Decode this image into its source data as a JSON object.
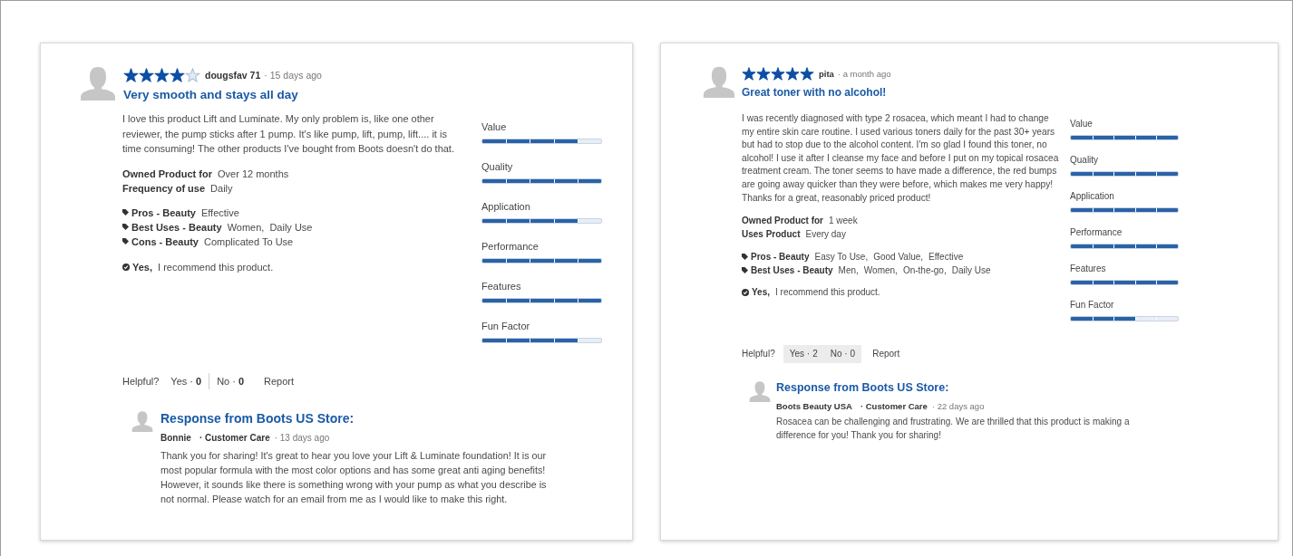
{
  "reviews": [
    {
      "reviewer": "dougsfav 71",
      "time": "· 15 days ago",
      "stars": 4,
      "title": "Very smooth and stays all day",
      "body": "I love this product Lift and Luminate. My only problem is, like one other reviewer, the pump sticks after 1 pump. It's like pump, lift, pump, lift.... it is time consuming! The other products I've bought from Boots doesn't do that.",
      "details": [
        {
          "label": "Owned Product for",
          "value": "Over 12 months"
        },
        {
          "label": "Frequency of use",
          "value": "Daily"
        }
      ],
      "tags": [
        {
          "label": "Pros - Beauty",
          "values": [
            "Effective"
          ]
        },
        {
          "label": "Best Uses - Beauty",
          "values": [
            "Women,",
            "Daily Use"
          ]
        },
        {
          "label": "Cons - Beauty",
          "values": [
            "Complicated To Use"
          ]
        }
      ],
      "recommend": {
        "answer": "Yes,",
        "text": "I recommend this product."
      },
      "ratings": [
        {
          "name": "Value",
          "level": 0.8
        },
        {
          "name": "Quality",
          "level": 1
        },
        {
          "name": "Application",
          "level": 0.8
        },
        {
          "name": "Performance",
          "level": 1
        },
        {
          "name": "Features",
          "level": 1
        },
        {
          "name": "Fun Factor",
          "level": 0.8
        }
      ],
      "helpful": {
        "label": "Helpful?",
        "highlighted": false,
        "yes": {
          "label": "Yes ·",
          "count": "0"
        },
        "no": {
          "label": "No ·",
          "count": "0"
        },
        "report": "Report"
      },
      "response": {
        "title": "Response from Boots US Store:",
        "author": "Bonnie",
        "role": "· Customer Care",
        "time": "· 13 days ago",
        "body": "Thank you for sharing! It's great to hear you love your Lift & Luminate foundation! It is our most popular formula with the most color options and has some great anti aging benefits! However, it sounds like there is something wrong with your pump as what you describe is not normal. Please watch for an email from me as I would like to make this right."
      }
    },
    {
      "reviewer": "pita",
      "time": "· a month ago",
      "stars": 5,
      "title": "Great toner with no alcohol!",
      "body": "I was recently diagnosed with type 2 rosacea, which meant I had to change my entire skin care routine. I used various toners daily for the past 30+ years but had to stop due to the alcohol content. I'm so glad I found this toner, no alcohol! I use it after I cleanse my face and before I put on my topical rosacea treatment cream. The toner seems to have made a difference, the red bumps are going away quicker than they were before, which makes me very happy! Thanks for a great, reasonably priced product!",
      "details": [
        {
          "label": "Owned Product for",
          "value": "1 week"
        },
        {
          "label": "Uses Product",
          "value": "Every day"
        }
      ],
      "tags": [
        {
          "label": "Pros - Beauty",
          "values": [
            "Easy To Use,",
            "Good Value,",
            "Effective"
          ]
        },
        {
          "label": "Best Uses - Beauty",
          "values": [
            "Men,",
            "Women,",
            "On-the-go,",
            "Daily Use"
          ]
        }
      ],
      "recommend": {
        "answer": "Yes,",
        "text": "I recommend this product."
      },
      "ratings": [
        {
          "name": "Value",
          "level": 1
        },
        {
          "name": "Quality",
          "level": 1
        },
        {
          "name": "Application",
          "level": 1
        },
        {
          "name": "Performance",
          "level": 1
        },
        {
          "name": "Features",
          "level": 1
        },
        {
          "name": "Fun Factor",
          "level": 0.6
        }
      ],
      "helpful": {
        "label": "Helpful?",
        "highlighted": true,
        "yes": {
          "label": "Yes ·",
          "count": "2"
        },
        "no": {
          "label": "No ·",
          "count": "0"
        },
        "report": "Report"
      },
      "response": {
        "title": "Response from Boots US Store:",
        "author": "Boots Beauty USA",
        "role": "· Customer Care",
        "time": "· 22 days ago",
        "body": "Rosacea can be challenging and frustrating. We are thrilled that this product is making a difference for you! Thank you for sharing!"
      }
    }
  ]
}
